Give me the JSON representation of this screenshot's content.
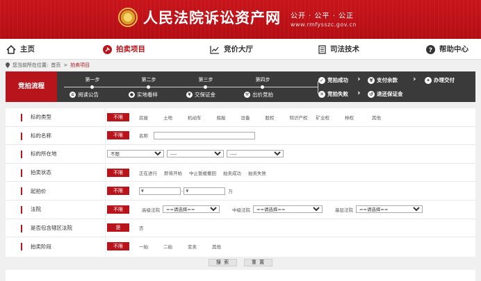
{
  "header": {
    "site_title": "人民法院诉讼资产网",
    "slogan": "公开 · 公平 · 公正",
    "domain": "www.rmfysszc.gov.cn",
    "brand_color": "#b8141b"
  },
  "nav": {
    "items": [
      {
        "label": "主页",
        "icon": "home-icon"
      },
      {
        "label": "拍卖项目",
        "icon": "gavel-icon",
        "active": true
      },
      {
        "label": "竞价大厅",
        "icon": "chart-icon"
      },
      {
        "label": "司法技术",
        "icon": "document-icon"
      },
      {
        "label": "帮助中心",
        "icon": "help-icon"
      }
    ]
  },
  "breadcrumb": {
    "prefix": "您当前所在位置:",
    "home": "首页",
    "sep": ">",
    "current": "拍卖项目"
  },
  "flow": {
    "title": "竞拍流程",
    "steps": [
      {
        "label": "第一步",
        "action": "阅读公告"
      },
      {
        "label": "第二步",
        "action": "实地看样"
      },
      {
        "label": "第三步",
        "action": "交保证金"
      },
      {
        "label": "第四步",
        "action": "出价竞拍"
      }
    ],
    "success": "竞拍成功",
    "fail": "竞拍失败",
    "pay_rest": "支付余款",
    "handover": "办理交付",
    "refund": "退还保证金"
  },
  "filters": {
    "unlimited": "不限",
    "type": {
      "label": "标的类型",
      "options": [
        "房屋",
        "土地",
        "机动车",
        "船舶",
        "设备",
        "股权",
        "知识产权",
        "矿业权",
        "林权",
        "其他"
      ]
    },
    "name": {
      "label": "标的名称",
      "sub_label": "名称",
      "value": ""
    },
    "location": {
      "label": "标的所在地",
      "province": "不限",
      "city": "----",
      "district": "----"
    },
    "status": {
      "label": "拍卖状态",
      "options": [
        "正在进行",
        "即将开始",
        "中止暂缓撤回",
        "拍卖成功",
        "拍卖失败"
      ]
    },
    "price": {
      "label": "起拍价",
      "from_prefix": "¥",
      "sep": "-",
      "to_prefix": "¥",
      "unit": "万"
    },
    "court": {
      "label": "法院",
      "senior_label": "高级法院",
      "mid_label": "中级法院",
      "base_label": "基层法院",
      "placeholder": "==请选择=="
    },
    "include_sub": {
      "label": "是否包含辖区法院",
      "yes": "是",
      "no": "否"
    },
    "stage": {
      "label": "拍卖阶段",
      "options": [
        "一拍",
        "二拍",
        "变卖",
        "其他"
      ]
    }
  },
  "buttons": {
    "search": "搜 索",
    "reset": "重 置"
  }
}
